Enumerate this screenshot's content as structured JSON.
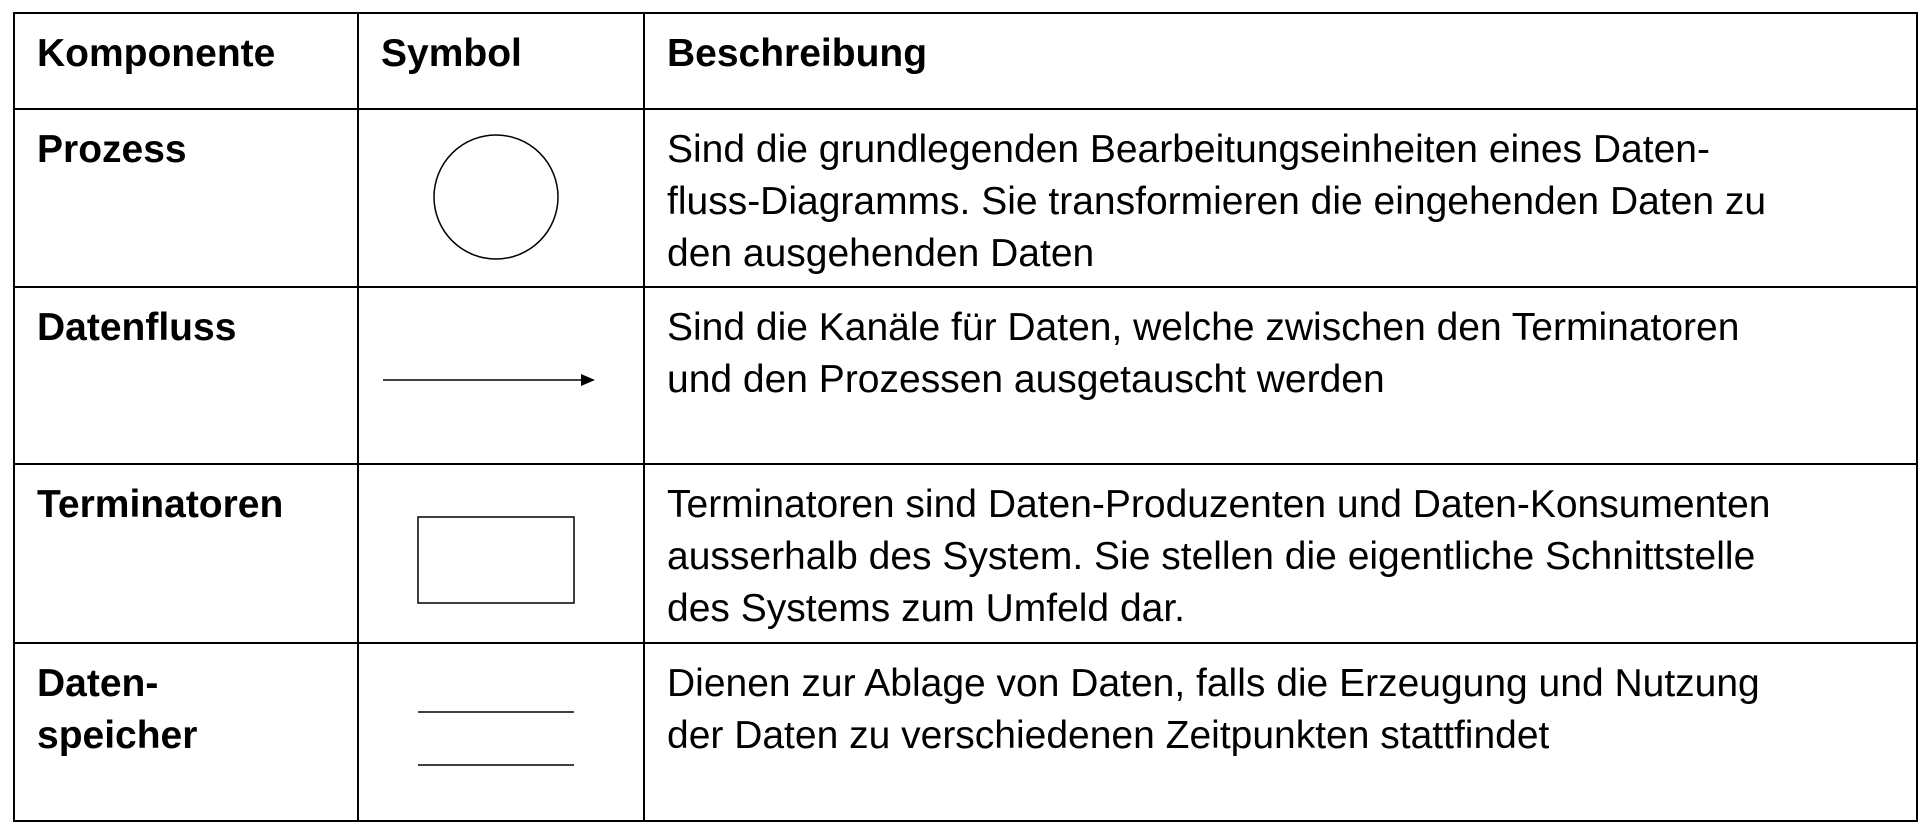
{
  "table": {
    "headers": [
      "Komponente",
      "Symbol",
      "Beschreibung"
    ],
    "rows": [
      {
        "component": "Prozess",
        "symbol": "circle-icon",
        "description": "Sind die grundlegenden Bearbeitungseinheiten eines Daten-\nfluss-Diagramms. Sie transformieren die eingehenden Daten zu\nden ausgehenden Daten"
      },
      {
        "component": "Datenfluss",
        "symbol": "arrow-right-icon",
        "description": "Sind die Kanäle für Daten, welche zwischen den Terminatoren\nund den Prozessen ausgetauscht werden"
      },
      {
        "component": "Terminatoren",
        "symbol": "rectangle-icon",
        "description": "Terminatoren sind Daten-Produzenten und Daten-Konsumenten\nausserhalb des System. Sie stellen die eigentliche Schnittstelle\ndes Systems zum Umfeld dar."
      },
      {
        "component": "Daten-\nspeicher",
        "symbol": "parallel-lines-icon",
        "description": "Dienen zur Ablage von Daten, falls die Erzeugung und  Nutzung\nder Daten zu verschiedenen Zeitpunkten stattfindet"
      }
    ]
  }
}
